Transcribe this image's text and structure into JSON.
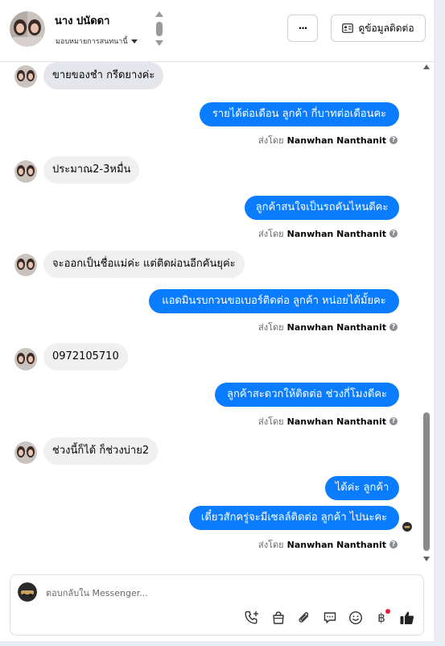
{
  "header": {
    "name": "นาง ปนัดดา",
    "assign_label": "มอบหมายการสนทนานี้",
    "more_label": "···",
    "contact_button": "ดูข้อมูลติดต่อ"
  },
  "messages": [
    {
      "dir": "in",
      "text": "ขายของชำ กรีดยางค่ะ"
    },
    {
      "dir": "out",
      "text": "รายได้ต่อเดือน ลูกค้า กี่บาทต่อเดือนคะ"
    },
    {
      "dir": "in",
      "text": "ประมาณ2-3หมื่น"
    },
    {
      "dir": "out",
      "text": "ลูกค้าสนใจเป็นรถคันไหนดีคะ"
    },
    {
      "dir": "in",
      "text": "จะออกเป็นชื่อแม่ค่ะ แต่ติดผ่อนอีกคันยุค่ะ"
    },
    {
      "dir": "out",
      "text": "แอดมินรบกวนขอเบอร์ติดต่อ ลูกค้า หน่อยได้มั้ยคะ"
    },
    {
      "dir": "in",
      "text": "0972105710"
    },
    {
      "dir": "out",
      "text": "ลูกค้าสะดวกให้ติดต่อ ช่วงกี่โมงดีคะ"
    },
    {
      "dir": "in",
      "text": "ช่วงนี้ก็ได้ ก็ช่วงบ่าย2"
    },
    {
      "dir": "out",
      "text": "ได้ค่ะ  ลูกค้า"
    },
    {
      "dir": "out",
      "text": "เดี๋ยวสักครู่จะมีเซลล์ติดต่อ ลูกค้า ไปนะคะ"
    }
  ],
  "sent_by": {
    "prefix": "ส่งโดย",
    "name": "Nanwhan Nanthanit"
  },
  "composer": {
    "placeholder": "ตอบกลับใน Messenger..."
  },
  "icons": {
    "tools": [
      "phone-plus-icon",
      "shopping-bag-icon",
      "paperclip-icon",
      "chat-bubble-icon",
      "smile-icon",
      "baht-icon",
      "thumbs-up-icon"
    ],
    "baht_symbol": "฿"
  },
  "colors": {
    "outgoing_bubble": "#0a7cff",
    "incoming_bubble": "#f0f0f0",
    "notification_dot": "#e41e3f"
  }
}
